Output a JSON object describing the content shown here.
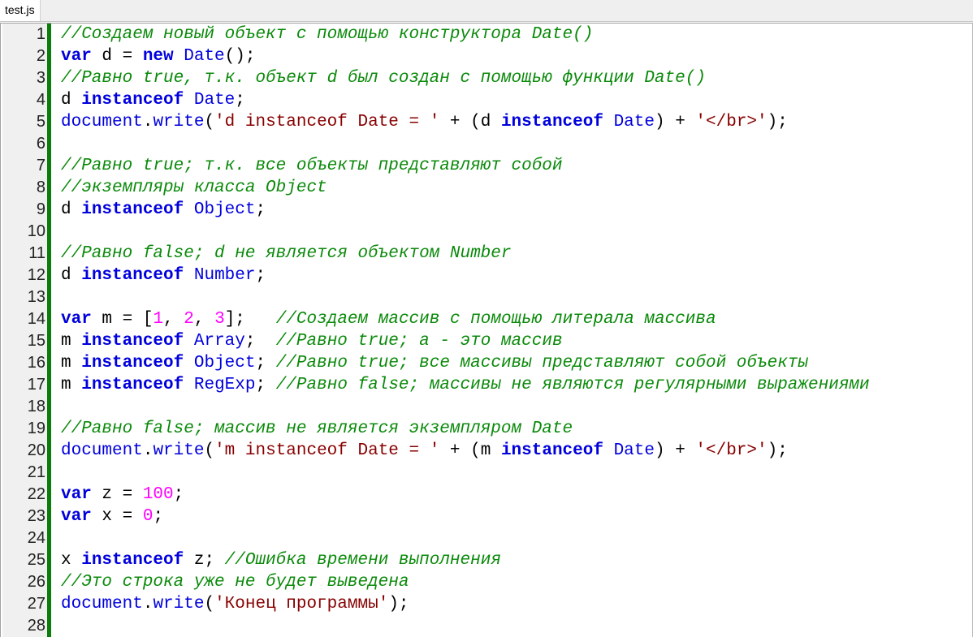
{
  "tab": {
    "label": "test.js"
  },
  "colors": {
    "keyword": "#0000dd",
    "comment": "#0a8a0a",
    "identifier": "#0000dd",
    "string": "#880000",
    "number": "#ff00ff",
    "change_bar": "#0a7d0a"
  },
  "lines": [
    {
      "n": "1",
      "tokens": [
        {
          "t": "cm",
          "v": "//Создаем новый объект с помощью конструктора Date()"
        }
      ]
    },
    {
      "n": "2",
      "tokens": [
        {
          "t": "kw",
          "v": "var"
        },
        {
          "t": "pl",
          "v": " d = "
        },
        {
          "t": "kw",
          "v": "new"
        },
        {
          "t": "pl",
          "v": " "
        },
        {
          "t": "id",
          "v": "Date"
        },
        {
          "t": "pl",
          "v": "();"
        }
      ]
    },
    {
      "n": "3",
      "tokens": [
        {
          "t": "cm",
          "v": "//Равно true, т.к. объект d был создан с помощью функции Date()"
        }
      ]
    },
    {
      "n": "4",
      "tokens": [
        {
          "t": "pl",
          "v": "d "
        },
        {
          "t": "kw",
          "v": "instanceof"
        },
        {
          "t": "pl",
          "v": " "
        },
        {
          "t": "id",
          "v": "Date"
        },
        {
          "t": "pl",
          "v": ";"
        }
      ]
    },
    {
      "n": "5",
      "tokens": [
        {
          "t": "id",
          "v": "document"
        },
        {
          "t": "pl",
          "v": "."
        },
        {
          "t": "id",
          "v": "write"
        },
        {
          "t": "pl",
          "v": "("
        },
        {
          "t": "str",
          "v": "'d instanceof Date = '"
        },
        {
          "t": "pl",
          "v": " + (d "
        },
        {
          "t": "kw",
          "v": "instanceof"
        },
        {
          "t": "pl",
          "v": " "
        },
        {
          "t": "id",
          "v": "Date"
        },
        {
          "t": "pl",
          "v": ") + "
        },
        {
          "t": "str",
          "v": "'</br>'"
        },
        {
          "t": "pl",
          "v": ");"
        }
      ]
    },
    {
      "n": "6",
      "tokens": []
    },
    {
      "n": "7",
      "tokens": [
        {
          "t": "cm",
          "v": "//Равно true; т.к. все объекты представляют собой"
        }
      ]
    },
    {
      "n": "8",
      "tokens": [
        {
          "t": "cm",
          "v": "//экземпляры класса Object"
        }
      ]
    },
    {
      "n": "9",
      "tokens": [
        {
          "t": "pl",
          "v": "d "
        },
        {
          "t": "kw",
          "v": "instanceof"
        },
        {
          "t": "pl",
          "v": " "
        },
        {
          "t": "id",
          "v": "Object"
        },
        {
          "t": "pl",
          "v": ";"
        }
      ]
    },
    {
      "n": "10",
      "tokens": []
    },
    {
      "n": "11",
      "tokens": [
        {
          "t": "cm",
          "v": "//Равно false; d не является объектом Number"
        }
      ]
    },
    {
      "n": "12",
      "tokens": [
        {
          "t": "pl",
          "v": "d "
        },
        {
          "t": "kw",
          "v": "instanceof"
        },
        {
          "t": "pl",
          "v": " "
        },
        {
          "t": "id",
          "v": "Number"
        },
        {
          "t": "pl",
          "v": ";"
        }
      ]
    },
    {
      "n": "13",
      "tokens": []
    },
    {
      "n": "14",
      "tokens": [
        {
          "t": "kw",
          "v": "var"
        },
        {
          "t": "pl",
          "v": " m = ["
        },
        {
          "t": "num",
          "v": "1"
        },
        {
          "t": "pl",
          "v": ", "
        },
        {
          "t": "num",
          "v": "2"
        },
        {
          "t": "pl",
          "v": ", "
        },
        {
          "t": "num",
          "v": "3"
        },
        {
          "t": "pl",
          "v": "];   "
        },
        {
          "t": "cm",
          "v": "//Создаем массив с помощью литерала массива"
        }
      ]
    },
    {
      "n": "15",
      "tokens": [
        {
          "t": "pl",
          "v": "m "
        },
        {
          "t": "kw",
          "v": "instanceof"
        },
        {
          "t": "pl",
          "v": " "
        },
        {
          "t": "id",
          "v": "Array"
        },
        {
          "t": "pl",
          "v": ";  "
        },
        {
          "t": "cm",
          "v": "//Равно true; a - это массив"
        }
      ]
    },
    {
      "n": "16",
      "tokens": [
        {
          "t": "pl",
          "v": "m "
        },
        {
          "t": "kw",
          "v": "instanceof"
        },
        {
          "t": "pl",
          "v": " "
        },
        {
          "t": "id",
          "v": "Object"
        },
        {
          "t": "pl",
          "v": "; "
        },
        {
          "t": "cm",
          "v": "//Равно true; все массивы представляют собой объекты"
        }
      ]
    },
    {
      "n": "17",
      "tokens": [
        {
          "t": "pl",
          "v": "m "
        },
        {
          "t": "kw",
          "v": "instanceof"
        },
        {
          "t": "pl",
          "v": " "
        },
        {
          "t": "id",
          "v": "RegExp"
        },
        {
          "t": "pl",
          "v": "; "
        },
        {
          "t": "cm",
          "v": "//Равно false; массивы не являются регулярными выражениями"
        }
      ]
    },
    {
      "n": "18",
      "tokens": []
    },
    {
      "n": "19",
      "tokens": [
        {
          "t": "cm",
          "v": "//Равно false; массив не является экземпляром Date"
        }
      ]
    },
    {
      "n": "20",
      "tokens": [
        {
          "t": "id",
          "v": "document"
        },
        {
          "t": "pl",
          "v": "."
        },
        {
          "t": "id",
          "v": "write"
        },
        {
          "t": "pl",
          "v": "("
        },
        {
          "t": "str",
          "v": "'m instanceof Date = '"
        },
        {
          "t": "pl",
          "v": " + (m "
        },
        {
          "t": "kw",
          "v": "instanceof"
        },
        {
          "t": "pl",
          "v": " "
        },
        {
          "t": "id",
          "v": "Date"
        },
        {
          "t": "pl",
          "v": ") + "
        },
        {
          "t": "str",
          "v": "'</br>'"
        },
        {
          "t": "pl",
          "v": ");"
        }
      ]
    },
    {
      "n": "21",
      "tokens": []
    },
    {
      "n": "22",
      "tokens": [
        {
          "t": "kw",
          "v": "var"
        },
        {
          "t": "pl",
          "v": " z = "
        },
        {
          "t": "num",
          "v": "100"
        },
        {
          "t": "pl",
          "v": ";"
        }
      ]
    },
    {
      "n": "23",
      "tokens": [
        {
          "t": "kw",
          "v": "var"
        },
        {
          "t": "pl",
          "v": " x = "
        },
        {
          "t": "num",
          "v": "0"
        },
        {
          "t": "pl",
          "v": ";"
        }
      ]
    },
    {
      "n": "24",
      "tokens": []
    },
    {
      "n": "25",
      "tokens": [
        {
          "t": "pl",
          "v": "x "
        },
        {
          "t": "kw",
          "v": "instanceof"
        },
        {
          "t": "pl",
          "v": " z; "
        },
        {
          "t": "cm",
          "v": "//Ошибка времени выполнения"
        }
      ]
    },
    {
      "n": "26",
      "tokens": [
        {
          "t": "cm",
          "v": "//Это строка уже не будет выведена"
        }
      ]
    },
    {
      "n": "27",
      "tokens": [
        {
          "t": "id",
          "v": "document"
        },
        {
          "t": "pl",
          "v": "."
        },
        {
          "t": "id",
          "v": "write"
        },
        {
          "t": "pl",
          "v": "("
        },
        {
          "t": "str",
          "v": "'Конец программы'"
        },
        {
          "t": "pl",
          "v": ");"
        }
      ]
    },
    {
      "n": "28",
      "tokens": []
    }
  ]
}
